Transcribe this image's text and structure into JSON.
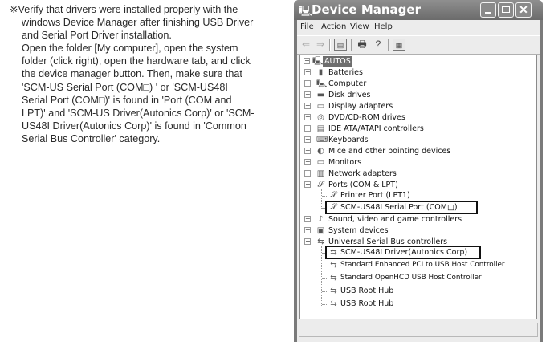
{
  "instructions": {
    "line1": "※Verify that drivers were installed properly with the",
    "line2": "windows Device Manager after finishing USB Driver",
    "line3": "and Serial Port Driver installation.",
    "line4": "Open the folder [My computer], open the system",
    "line5": "folder (click right), open the hardware tab, and click",
    "line6": "the device manager button. Then, make sure that",
    "line7": "'SCM-US Serial Port (COM□) ' or 'SCM-US48I",
    "line8": "Serial Port (COM□)' is found in 'Port (COM and",
    "line9": "LPT)' and 'SCM-US Driver(Autonics Corp)' or 'SCM-",
    "line10": "US48I Driver(Autonics Corp)' is found in 'Common",
    "line11": "Serial Bus Controller' category."
  },
  "window": {
    "title": "Device Manager",
    "controls": {
      "minimize": "minimize",
      "maximize": "maximize",
      "close": "✕"
    }
  },
  "menu": {
    "file": "File",
    "action": "Action",
    "view": "View",
    "help": "Help"
  },
  "toolbar_icons": [
    "back-arrow",
    "forward-arrow",
    "properties",
    "print",
    "help",
    "scan-hardware"
  ],
  "tree": {
    "root": "AUTOS",
    "categories": {
      "batteries": "Batteries",
      "computer": "Computer",
      "disk": "Disk drives",
      "display": "Display adapters",
      "dvd": "DVD/CD-ROM drives",
      "ide": "IDE ATA/ATAPI controllers",
      "keyboards": "Keyboards",
      "mice": "Mice and other pointing devices",
      "monitors": "Monitors",
      "network": "Network adapters",
      "ports": "Ports (COM & LPT)",
      "sound": "Sound, video and game controllers",
      "system": "System devices",
      "usb": "Universal Serial Bus controllers"
    },
    "ports_children": [
      "Printer Port (LPT1)",
      "SCM-US48I Serial Port (COM□)"
    ],
    "usb_children": [
      "SCM-US48I Driver(Autonics Corp)",
      "Standard Enhanced PCI to USB Host Controller",
      "Standard OpenHCD USB Host Controller",
      "USB Root Hub",
      "USB Root Hub"
    ]
  }
}
